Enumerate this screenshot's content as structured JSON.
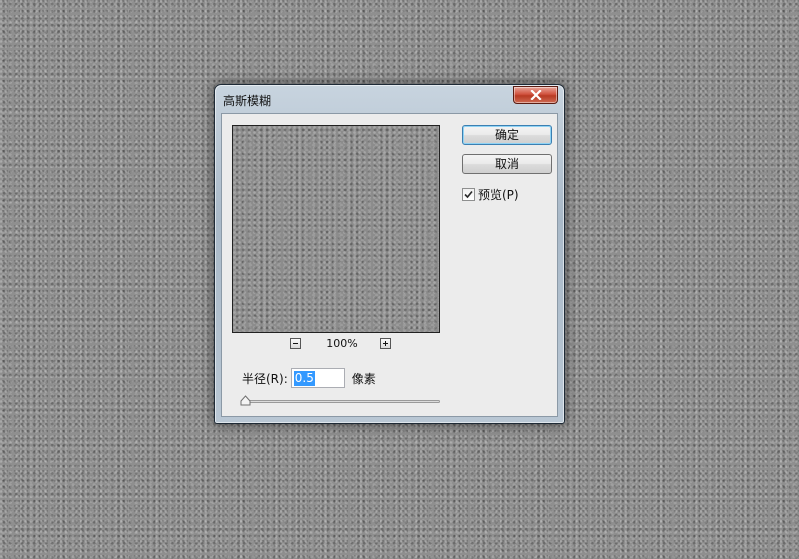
{
  "dialog": {
    "title": "高斯模糊"
  },
  "buttons": {
    "ok_label": "确定",
    "cancel_label": "取消"
  },
  "preview_option": {
    "label": "预览(P)",
    "checked": true
  },
  "zoom": {
    "level": "100%"
  },
  "radius": {
    "label": "半径(R):",
    "value": "0.5",
    "unit": "像素",
    "slider_fraction": 0.0
  },
  "icons": {
    "close": "close-icon",
    "zoom_out": "minus-icon",
    "zoom_in": "plus-icon",
    "check": "checkmark-icon",
    "slider": "slider-thumb-icon"
  }
}
